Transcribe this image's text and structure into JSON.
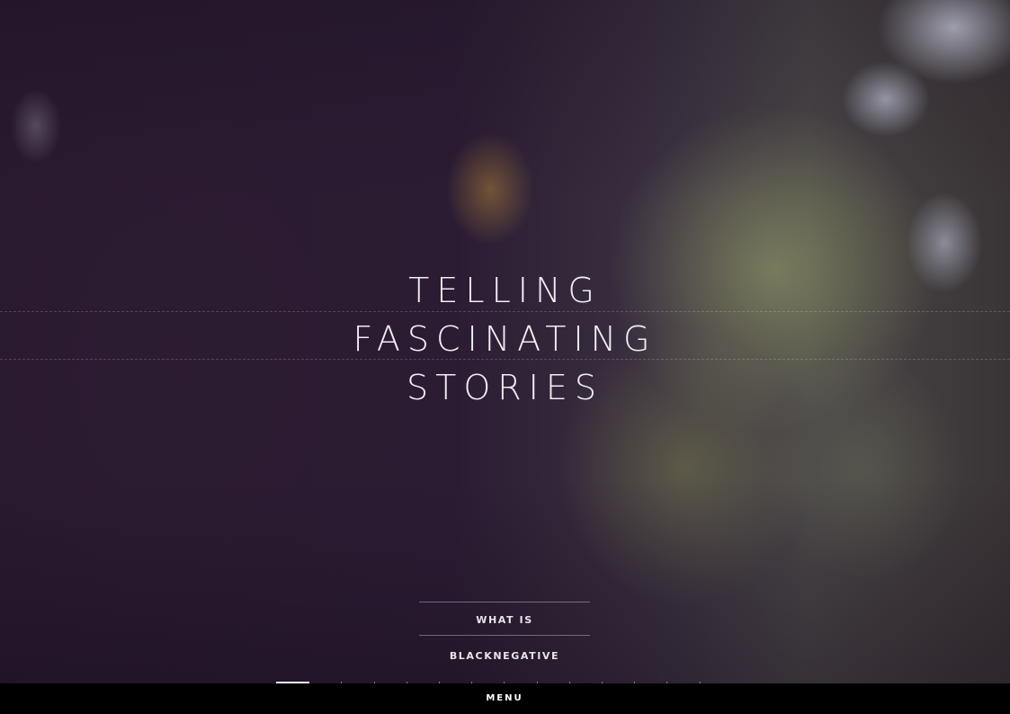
{
  "hero": {
    "headline_lines": [
      "TELLING",
      "FASCINATING",
      "STORIES"
    ],
    "cta_label": "WHAT IS BLACKNEGATIVE"
  },
  "slideshow": {
    "total_slides": 14,
    "active_index": 0
  },
  "menubar": {
    "menu_label": "MENU"
  },
  "colors": {
    "menubar_bg": "#000000",
    "text": "#f2eef4",
    "overlay": "#2a1a30"
  }
}
